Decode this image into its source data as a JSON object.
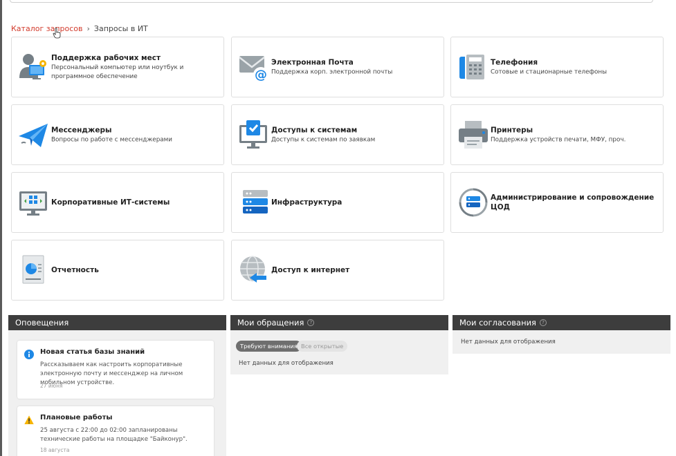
{
  "breadcrumb": {
    "catalog": "Каталог запросов",
    "current": "Запросы в ИТ"
  },
  "tiles": [
    {
      "title": "Поддержка рабочих мест",
      "desc": "Персональный компьютер или ноутбук и программное обеспечение",
      "icon": "workplace-icon"
    },
    {
      "title": "Электронная Почта",
      "desc": "Поддержка корп. электронной почты",
      "icon": "email-icon"
    },
    {
      "title": "Телефония",
      "desc": "Сотовые и стационарные телефоны",
      "icon": "phone-icon"
    },
    {
      "title": "Мессенджеры",
      "desc": "Вопросы по работе с мессенджерами",
      "icon": "paper-plane-icon"
    },
    {
      "title": "Доступы к системам",
      "desc": "Доступы к системам по заявкам",
      "icon": "monitor-check-icon"
    },
    {
      "title": "Принтеры",
      "desc": "Поддержка устройств печати, МФУ, проч.",
      "icon": "printer-icon"
    },
    {
      "title": "Корпоративные ИТ-системы",
      "desc": "",
      "icon": "corporate-systems-icon"
    },
    {
      "title": "Инфраструктура",
      "desc": "",
      "icon": "server-icon"
    },
    {
      "title": "Администрирование и сопровождение ЦОД",
      "desc": "",
      "icon": "datacenter-cycle-icon"
    },
    {
      "title": "Отчетность",
      "desc": "",
      "icon": "report-icon"
    },
    {
      "title": "Доступ к интернет",
      "desc": "",
      "icon": "globe-icon"
    }
  ],
  "notifications": {
    "title": "Оповещения",
    "items": [
      {
        "title": "Новая статья базы знаний",
        "text": "Рассказываем как настроить корпоративные электронную почту и мессенджер на личном мобильном устройстве.",
        "date": "27 июня",
        "icon": "info-icon"
      },
      {
        "title": "Плановые работы",
        "text": "25 августа с 22:00 до 02:00 запланированы технические работы на площадке \"Байконур\".",
        "date": "18 августа",
        "icon": "warning-icon"
      }
    ]
  },
  "my_requests": {
    "title": "Мои обращения",
    "tab_attention": "Требуют внимания",
    "tab_open": "Все открытые",
    "empty": "Нет данных для отображения"
  },
  "my_approvals": {
    "title": "Мои согласования",
    "empty": "Нет данных для отображения"
  },
  "colors": {
    "accent_red": "#d23b2c",
    "header_dark": "#3d3d3d",
    "icon_blue": "#1e88e5",
    "icon_gray": "#757f86"
  }
}
